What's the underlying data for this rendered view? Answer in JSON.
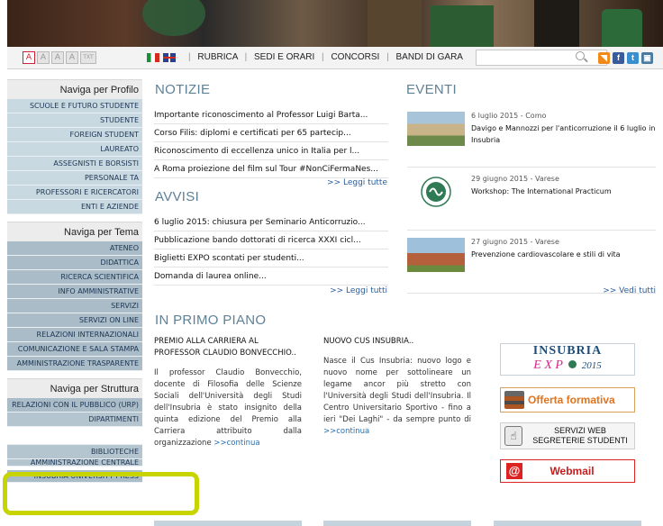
{
  "header": {
    "font_size_buttons": [
      "A",
      "A",
      "A",
      "A",
      "TXT"
    ],
    "nav": [
      "RUBRICA",
      "SEDI E ORARI",
      "CONCORSI",
      "BANDI DI GARA"
    ],
    "search": {
      "placeholder": "",
      "value": ""
    },
    "social_icons": [
      "rss-icon",
      "facebook-icon",
      "twitter-icon",
      "instagram-icon"
    ],
    "social_glyphs": [
      "◥",
      "f",
      "t",
      "▣"
    ]
  },
  "sidebar": {
    "profilo": {
      "title": "Naviga per Profilo",
      "items": [
        "SCUOLE E FUTURO STUDENTE",
        "STUDENTE",
        "FOREIGN STUDENT",
        "LAUREATO",
        "ASSEGNISTI E BORSISTI",
        "PERSONALE TA",
        "PROFESSORI E RICERCATORI",
        "ENTI E AZIENDE"
      ]
    },
    "tema": {
      "title": "Naviga per Tema",
      "items": [
        "ATENEO",
        "DIDATTICA",
        "RICERCA SCIENTIFICA",
        "INFO AMMINISTRATIVE",
        "SERVIZI",
        "SERVIZI ON LINE",
        "RELAZIONI INTERNAZIONALI",
        "COMUNICAZIONE E SALA STAMPA",
        "AMMINISTRAZIONE TRASPARENTE"
      ]
    },
    "struttura": {
      "title": "Naviga per Struttura",
      "items": [
        "RELAZIONI CON IL PUBBLICO (URP)",
        "DIPARTIMENTI",
        "",
        "BIBLIOTECHE",
        "AMMINISTRAZIONE CENTRALE",
        "INSUBRIA UNIVERSITY PRESS"
      ]
    }
  },
  "notizie": {
    "title": "NOTIZIE",
    "items": [
      "Importante riconoscimento al Professor Luigi Barta...",
      "Corso Filis: diplomi e certificati per 65 partecip...",
      "Riconoscimento di eccellenza unico in Italia per l...",
      "A Roma proiezione del film sul Tour #NonCiFermaNes..."
    ],
    "more": ">> Leggi tutte"
  },
  "avvisi": {
    "title": "AVVISI",
    "items": [
      "6 luglio 2015: chiusura per Seminario Anticorruzio...",
      "Pubblicazione bando dottorati di ricerca XXXI cicl...",
      "Biglietti EXPO scontati per studenti...",
      "Domanda di laurea online..."
    ],
    "more": ">> Leggi tutti"
  },
  "eventi": {
    "title": "EVENTI",
    "items": [
      {
        "meta": "6 luglio 2015  -  Como",
        "title": "Davigo e Mannozzi per l'anticorruzione il 6 luglio in Insubria"
      },
      {
        "meta": "29 giugno 2015  -  Varese",
        "title": "Workshop: The International Practicum"
      },
      {
        "meta": "27 giugno 2015  -  Varese",
        "title": "Prevenzione cardiovascolare e stili di vita"
      }
    ],
    "more": ">> Vedi tutti"
  },
  "primo_piano": {
    "title": "IN PRIMO PIANO",
    "col1": {
      "title": "PREMIO ALLA CARRIERA AL PROFESSOR CLAUDIO BONVECCHIO..",
      "text": "Il professor Claudio Bonvecchio, docente di Filosofia delle Scienze Sociali dell'Università degli Studi dell'Insubria è stato insignito della quinta edizione del Premio alla Carriera attribuito dalla organizzazione",
      "continua": ">>continua"
    },
    "col2": {
      "title": "NUOVO CUS INSUBRIA..",
      "text": "Nasce il Cus Insubria: nuovo logo e nuovo nome per sottolineare un legame ancor più stretto con l'Università degli Studi dell'Insubria. Il Centro Universitario Sportivo - fino a ieri \"Dei Laghi\" - da sempre punto di",
      "continua": ">>continua"
    }
  },
  "promo": {
    "insubria": "INSUBRIA",
    "expo": "E X P",
    "expo_year": "2015",
    "offerta": "Offerta formativa",
    "servizi_line1": "SERVIZI WEB",
    "servizi_line2": "SEGRETERIE STUDENTI",
    "webmail": "Webmail"
  },
  "colors": {
    "section_heading": "#5e8196",
    "sidebar_light": "#c9d9e2",
    "sidebar_dark": "#a9bcc8",
    "highlight": "#c8d400",
    "link": "#2a5c9a"
  }
}
